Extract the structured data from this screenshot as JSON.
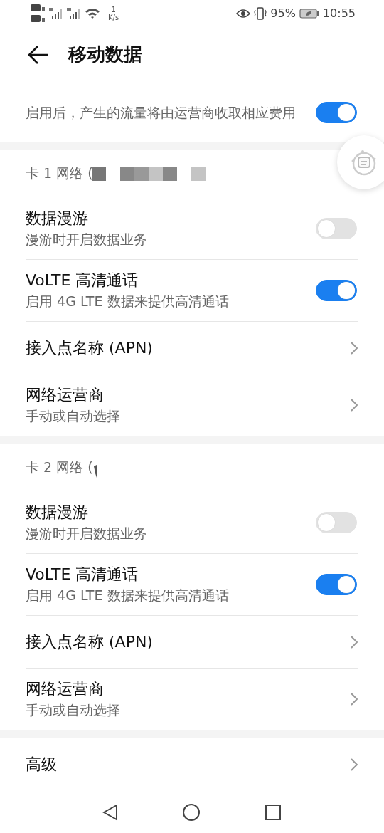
{
  "status_bar": {
    "speed_value": "1",
    "speed_unit": "K/s",
    "battery": "95%",
    "time": "10:55"
  },
  "header": {
    "title": "移动数据"
  },
  "top_item": {
    "subtitle": "启用后，产生的流量将由运营商收取相应费用",
    "on": true
  },
  "sections": [
    {
      "header": "卡 1 网络 (",
      "redacted": true,
      "items": [
        {
          "kind": "toggle",
          "title": "数据漫游",
          "subtitle": "漫游时开启数据业务",
          "on": false
        },
        {
          "kind": "toggle",
          "title": "VoLTE 高清通话",
          "subtitle": "启用 4G LTE 数据来提供高清通话",
          "on": true
        },
        {
          "kind": "link",
          "title": "接入点名称 (APN)"
        },
        {
          "kind": "link",
          "title": "网络运营商",
          "subtitle": "手动或自动选择"
        }
      ]
    },
    {
      "header": "卡 2 网络 (",
      "redacted": false,
      "items": [
        {
          "kind": "toggle",
          "title": "数据漫游",
          "subtitle": "漫游时开启数据业务",
          "on": false
        },
        {
          "kind": "toggle",
          "title": "VoLTE 高清通话",
          "subtitle": "启用 4G LTE 数据来提供高清通话",
          "on": true
        },
        {
          "kind": "link",
          "title": "接入点名称 (APN)"
        },
        {
          "kind": "link",
          "title": "网络运营商",
          "subtitle": "手动或自动选择"
        }
      ]
    },
    {
      "items": [
        {
          "kind": "link",
          "title": "高级"
        }
      ]
    }
  ]
}
